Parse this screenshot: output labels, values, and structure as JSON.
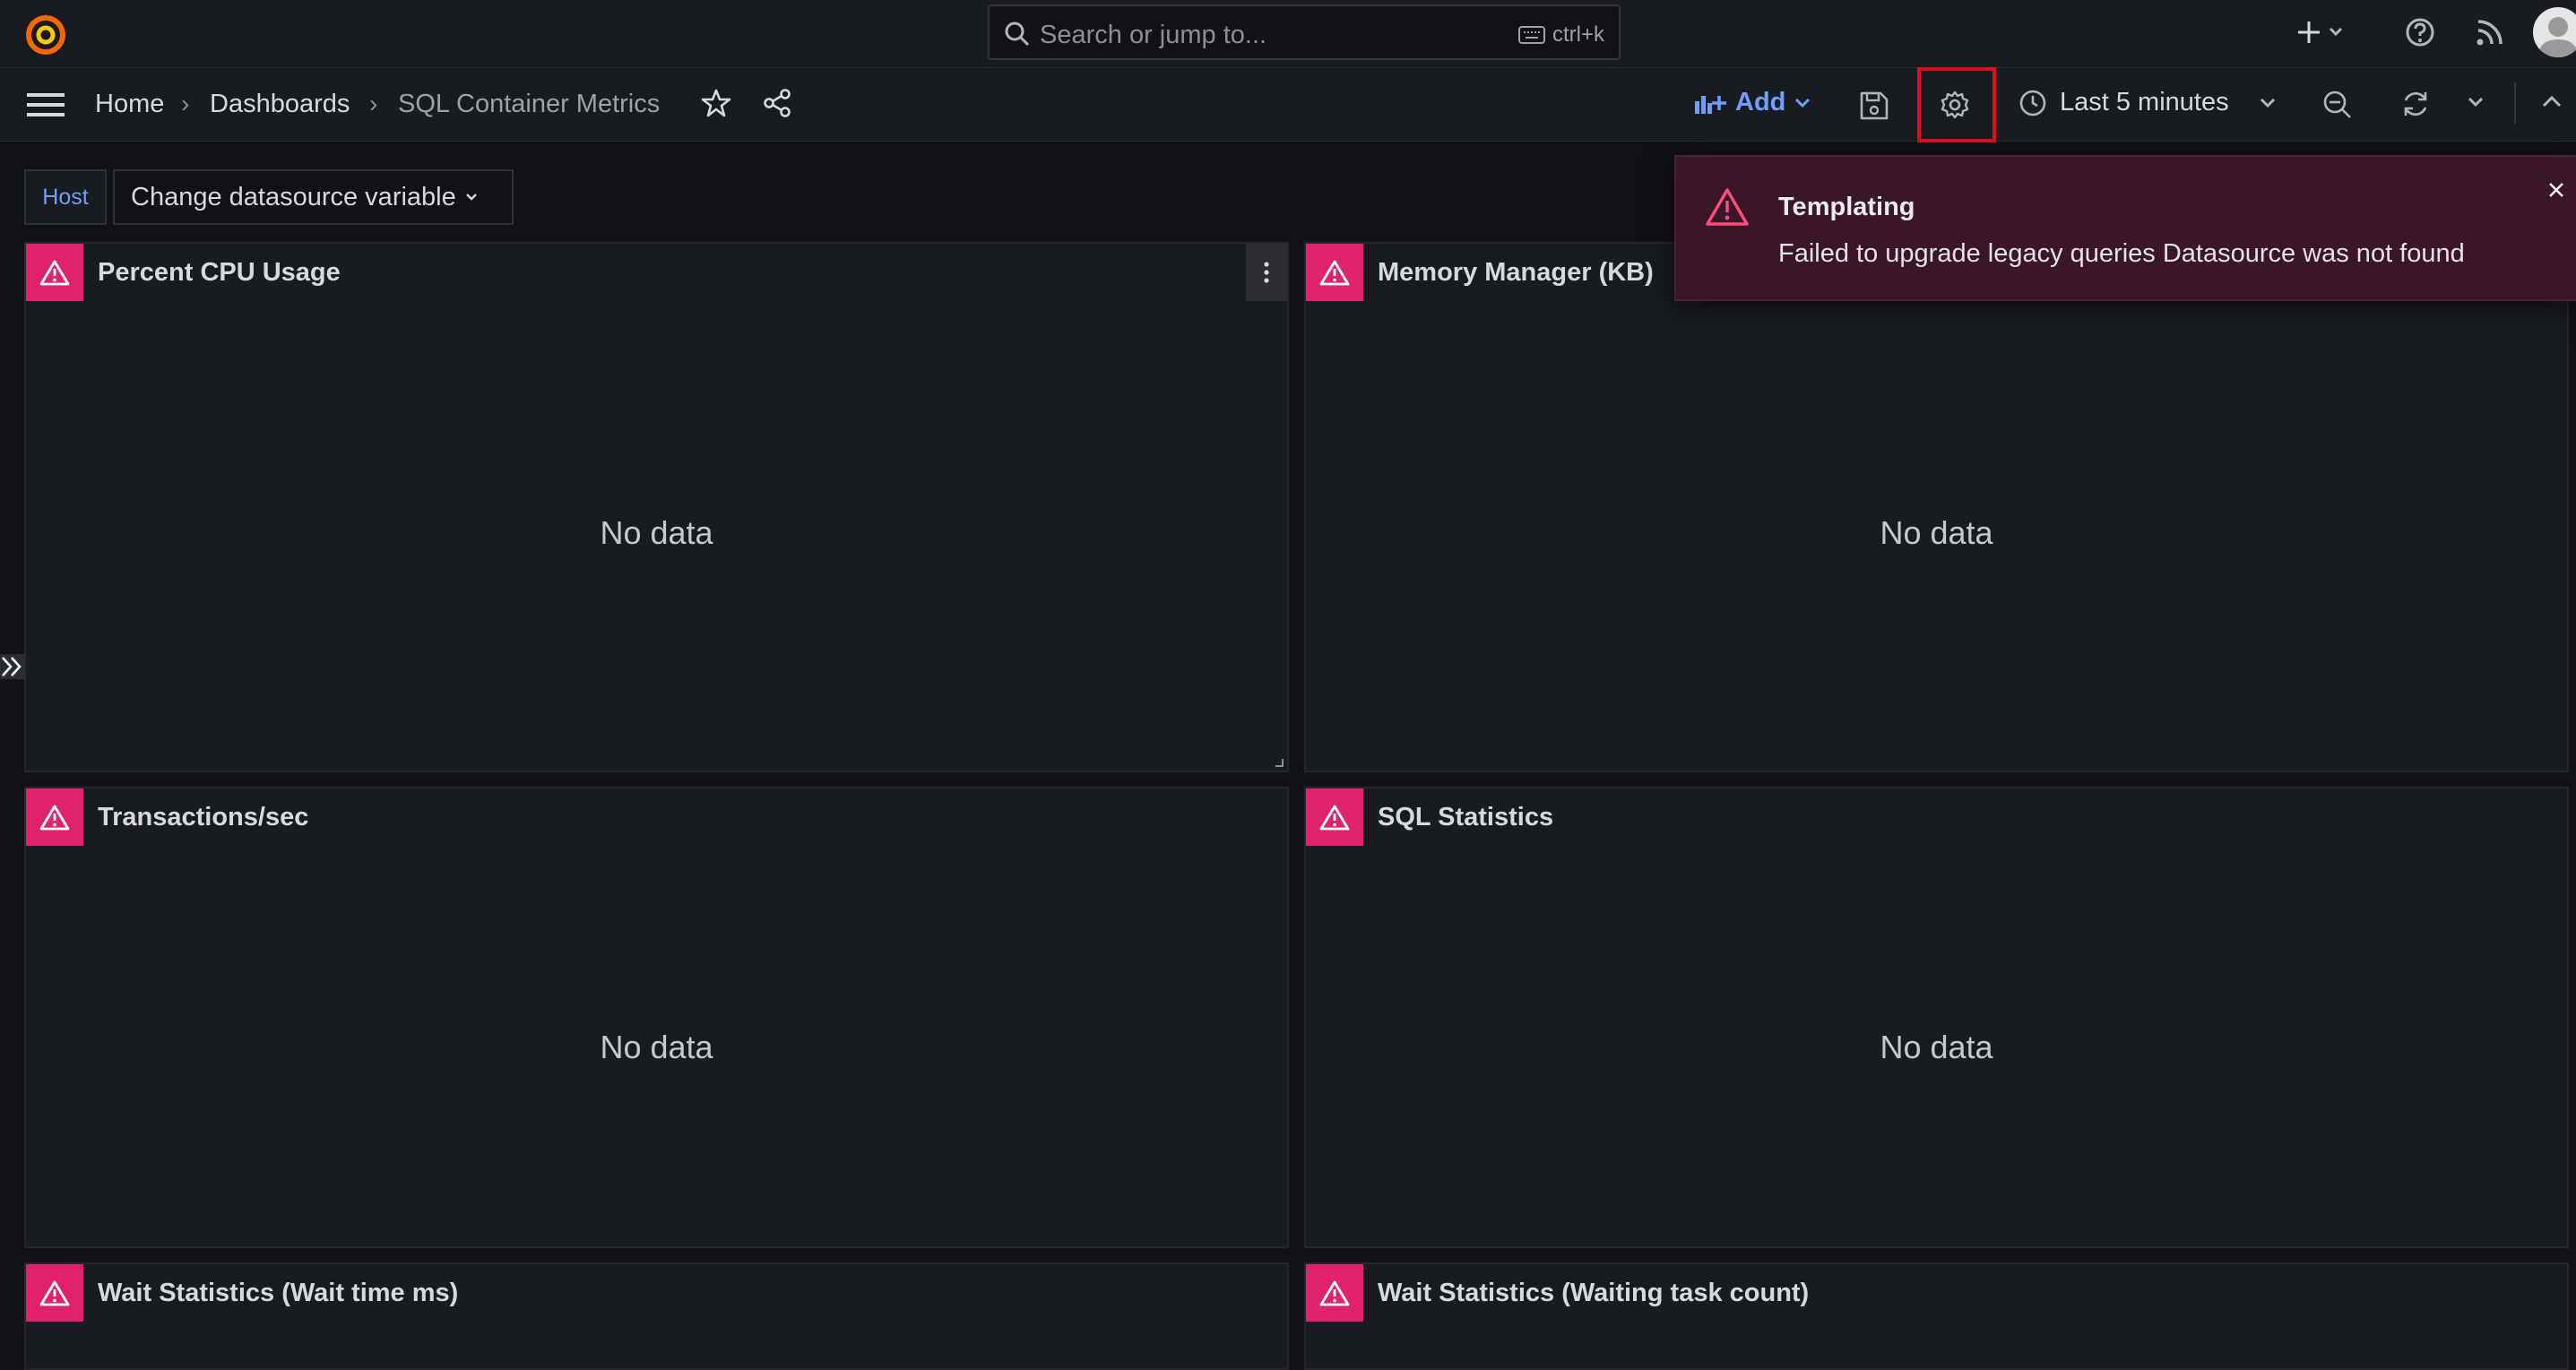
{
  "topbar": {
    "search_placeholder": "Search or jump to...",
    "search_shortcut": "ctrl+k"
  },
  "breadcrumb": {
    "home": "Home",
    "dashboards": "Dashboards",
    "current": "SQL Container Metrics"
  },
  "toolbar": {
    "add_label": "Add",
    "time_range": "Last 5 minutes"
  },
  "variables": {
    "label": "Host",
    "select_value": "Change datasource variable"
  },
  "panels": [
    {
      "title": "Percent CPU Usage",
      "message": "No data"
    },
    {
      "title": "Memory Manager (KB)",
      "message": "No data"
    },
    {
      "title": "Transactions/sec",
      "message": "No data"
    },
    {
      "title": "SQL Statistics",
      "message": "No data"
    },
    {
      "title": "Wait Statistics (Wait time ms)"
    },
    {
      "title": "Wait Statistics (Waiting task count)"
    }
  ],
  "toast": {
    "title": "Templating",
    "message": "Failed to upgrade legacy queries Datasource was not found"
  },
  "colors": {
    "background": "#111217",
    "panel": "#181b1f",
    "accent_blue": "#6e9fff",
    "error_pink": "#e0226e",
    "toast_bg": "#3a1628",
    "highlight_red": "#e0101a"
  }
}
